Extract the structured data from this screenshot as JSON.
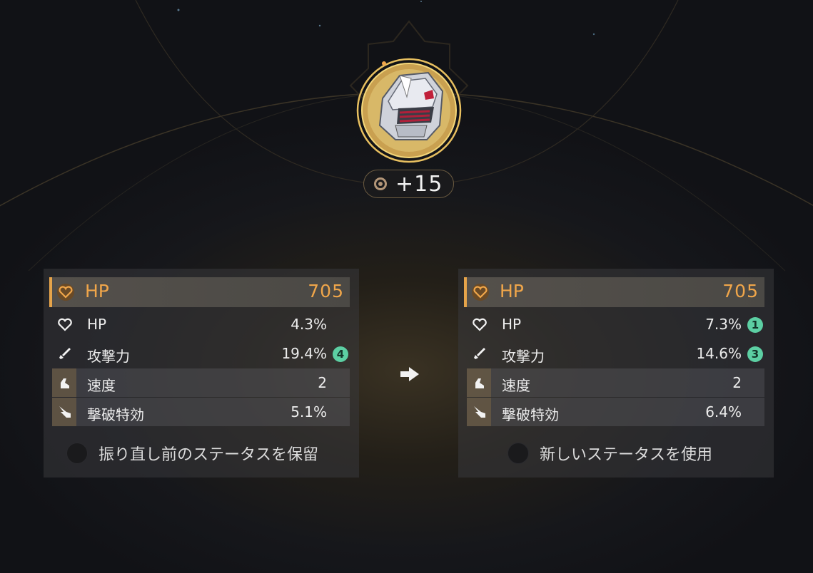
{
  "relic": {
    "level": "+15",
    "icon": "helmet-icon"
  },
  "panels": {
    "left": {
      "main_stat": {
        "name": "HP",
        "value": "705"
      },
      "sub_stats": [
        {
          "name": "HP",
          "value": "4.3%",
          "bonus": ""
        },
        {
          "name": "攻撃力",
          "value": "19.4%",
          "bonus": "4"
        },
        {
          "name": "速度",
          "value": "2",
          "bonus": ""
        },
        {
          "name": "撃破特効",
          "value": "5.1%",
          "bonus": ""
        }
      ],
      "choice_label": "振り直し前のステータスを保留"
    },
    "right": {
      "main_stat": {
        "name": "HP",
        "value": "705"
      },
      "sub_stats": [
        {
          "name": "HP",
          "value": "7.3%",
          "bonus": "1"
        },
        {
          "name": "攻撃力",
          "value": "14.6%",
          "bonus": "3"
        },
        {
          "name": "速度",
          "value": "2",
          "bonus": ""
        },
        {
          "name": "撃破特効",
          "value": "6.4%",
          "bonus": ""
        }
      ],
      "choice_label": "新しいステータスを使用"
    }
  },
  "colors": {
    "accent": "#f0a64a",
    "bonus": "#5ccfa3",
    "gold": "#e8c060"
  },
  "icons": {
    "hp": "heart-icon",
    "atk": "sword-icon",
    "spd": "boot-icon",
    "break": "burst-icon",
    "arrow": "arrow-right-icon"
  }
}
